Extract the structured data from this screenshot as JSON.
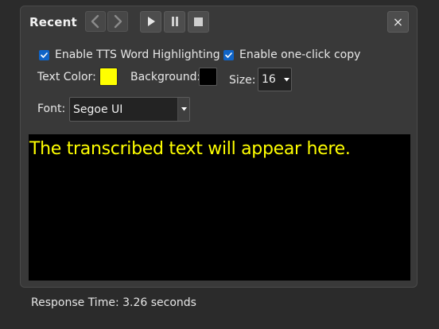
{
  "panel": {
    "title": "Recent",
    "close_symbol": "×"
  },
  "navigation": {
    "prev_icon": "chevron-left-icon",
    "next_icon": "chevron-right-icon"
  },
  "media": {
    "play_icon": "play-icon",
    "pause_icon": "pause-icon",
    "stop_icon": "stop-icon"
  },
  "options": {
    "tts_highlight_label": "Enable TTS Word Highlighting",
    "tts_highlight_checked": true,
    "one_click_copy_label": "Enable one-click copy",
    "one_click_copy_checked": true,
    "text_color_label": "Text Color:",
    "text_color": "#ffff00",
    "background_label": "Background:",
    "background_color": "#000000",
    "size_label": "Size:",
    "size_value": "16",
    "font_label": "Font:",
    "font_value": "Segoe UI"
  },
  "transcript": {
    "text": "The transcribed text will appear here."
  },
  "status": {
    "response_time": "Response Time: 3.26 seconds"
  },
  "colors": {
    "accent": "#0f64c8",
    "window_bg": "#2b2b2b",
    "panel_bg": "#393939"
  }
}
